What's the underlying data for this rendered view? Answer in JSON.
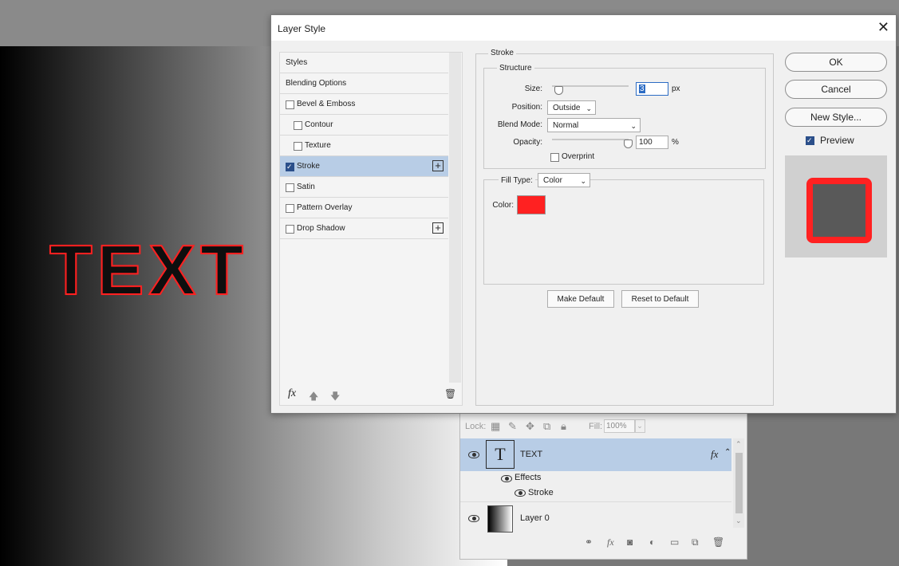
{
  "canvas": {
    "text": "TEXT"
  },
  "layers_panel": {
    "lock_label": "Lock:",
    "fill_label": "Fill:",
    "fill_value": "100%",
    "layers": [
      {
        "name": "TEXT",
        "fx": "fx"
      },
      {
        "name": "Layer 0"
      }
    ],
    "effects_label": "Effects",
    "stroke_label": "Stroke"
  },
  "dialog": {
    "title": "Layer Style",
    "close": "✕",
    "styles_list": [
      {
        "label": "Styles",
        "checkbox": false
      },
      {
        "label": "Blending Options",
        "checkbox": false
      },
      {
        "label": "Bevel & Emboss",
        "checkbox": true,
        "checked": false
      },
      {
        "label": "Contour",
        "checkbox": true,
        "checked": false
      },
      {
        "label": "Texture",
        "checkbox": true,
        "checked": false
      },
      {
        "label": "Stroke",
        "checkbox": true,
        "checked": true,
        "selected": true
      },
      {
        "label": "Satin",
        "checkbox": true,
        "checked": false
      },
      {
        "label": "Pattern Overlay",
        "checkbox": true,
        "checked": false
      },
      {
        "label": "Drop Shadow",
        "checkbox": true,
        "checked": false
      }
    ],
    "footer_fx": "fx",
    "stroke": {
      "section_title": "Stroke",
      "structure_title": "Structure",
      "size_label": "Size:",
      "size_value": "3",
      "size_unit": "px",
      "position_label": "Position:",
      "position_value": "Outside",
      "blend_mode_label": "Blend Mode:",
      "blend_mode_value": "Normal",
      "opacity_label": "Opacity:",
      "opacity_value": "100",
      "opacity_unit": "%",
      "overprint_label": "Overprint",
      "fill_type_label": "Fill Type:",
      "fill_type_value": "Color",
      "color_label": "Color:",
      "color_hex": "#ff2121",
      "make_default": "Make Default",
      "reset_default": "Reset to Default"
    },
    "buttons": {
      "ok": "OK",
      "cancel": "Cancel",
      "new_style": "New Style..."
    },
    "preview_label": "Preview"
  }
}
